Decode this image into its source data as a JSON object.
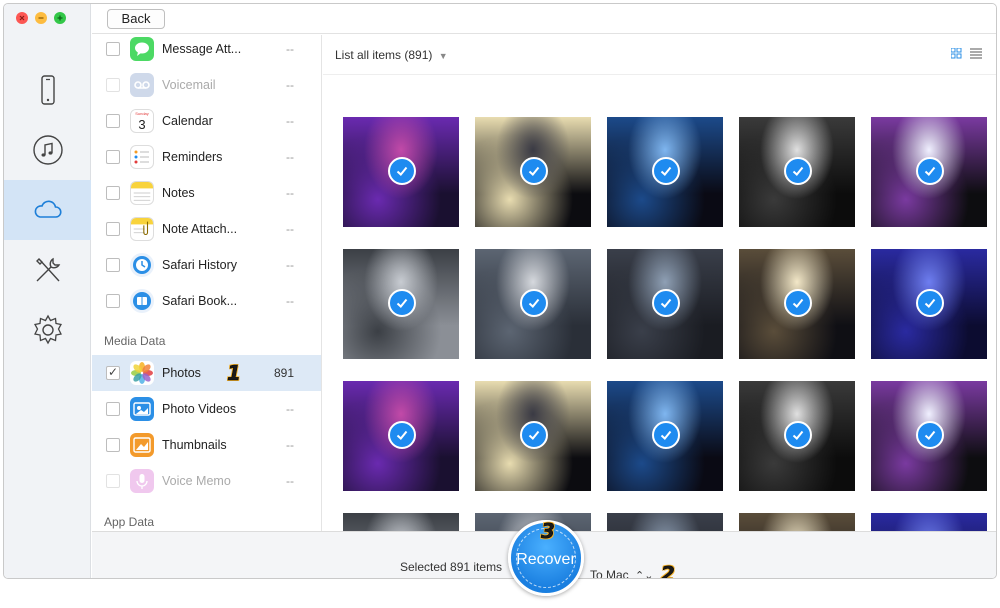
{
  "toolbar": {
    "back_label": "Back"
  },
  "colors": {
    "close": "#fc5753",
    "minimize": "#fdbc40",
    "zoom": "#33c748",
    "accent": "#1e8bf0",
    "rail_active": "#d3e4f6"
  },
  "rail": {
    "items": [
      "device-icon",
      "itunes-icon",
      "icloud-icon",
      "toolkit-icon",
      "settings-icon"
    ],
    "active": "icloud-icon"
  },
  "categories": {
    "rows": [
      {
        "label": "Message Att...",
        "count": "--",
        "enabled": true,
        "checked": false,
        "icon": "message-attachment-icon"
      },
      {
        "label": "Voicemail",
        "count": "--",
        "enabled": false,
        "checked": false,
        "icon": "voicemail-icon"
      },
      {
        "label": "Calendar",
        "count": "--",
        "enabled": true,
        "checked": false,
        "icon": "calendar-icon",
        "icon_text": "3"
      },
      {
        "label": "Reminders",
        "count": "--",
        "enabled": true,
        "checked": false,
        "icon": "reminders-icon"
      },
      {
        "label": "Notes",
        "count": "--",
        "enabled": true,
        "checked": false,
        "icon": "notes-icon"
      },
      {
        "label": "Note Attach...",
        "count": "--",
        "enabled": true,
        "checked": false,
        "icon": "note-attachment-icon"
      },
      {
        "label": "Safari History",
        "count": "--",
        "enabled": true,
        "checked": false,
        "icon": "safari-history-icon"
      },
      {
        "label": "Safari Book...",
        "count": "--",
        "enabled": true,
        "checked": false,
        "icon": "safari-bookmark-icon"
      }
    ],
    "media_heading": "Media Data",
    "media_rows": [
      {
        "label": "Photos",
        "count": "891",
        "enabled": true,
        "checked": true,
        "icon": "photos-icon",
        "annotation": "1"
      },
      {
        "label": "Photo Videos",
        "count": "--",
        "enabled": true,
        "checked": false,
        "icon": "photo-videos-icon"
      },
      {
        "label": "Thumbnails",
        "count": "--",
        "enabled": true,
        "checked": false,
        "icon": "thumbnails-icon"
      },
      {
        "label": "Voice Memo",
        "count": "--",
        "enabled": false,
        "checked": false,
        "icon": "voice-memo-icon"
      }
    ],
    "app_heading": "App Data"
  },
  "gallery": {
    "filter_label": "List all items (891)",
    "view_modes": [
      "grid-view-icon",
      "list-view-icon"
    ]
  },
  "bottom": {
    "selected_text": "Selected 891 items",
    "recover_label": "Recover",
    "recover_annotation": "3",
    "destination": "To Mac",
    "destination_annotation": "2"
  }
}
